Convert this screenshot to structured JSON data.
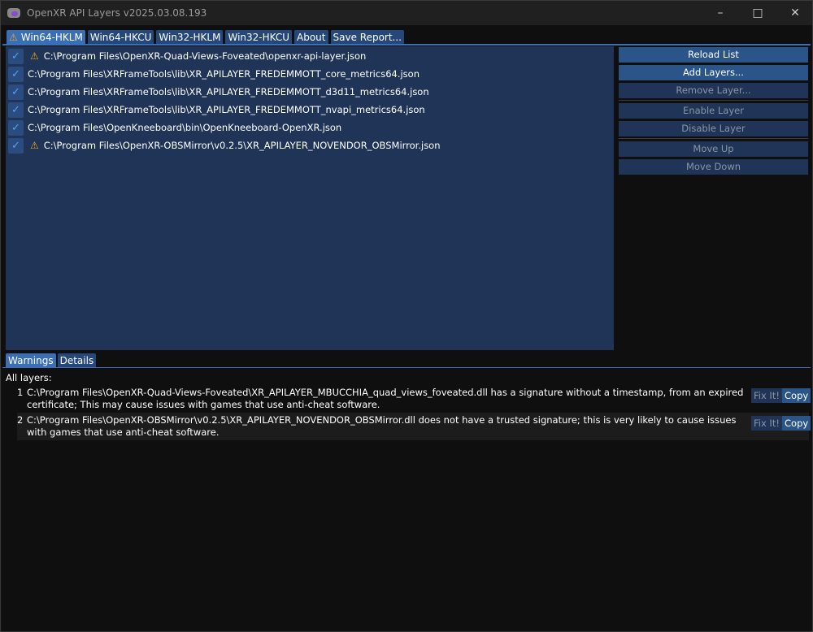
{
  "window": {
    "title": "OpenXR API Layers v2025.03.08.193"
  },
  "tabs": [
    {
      "label": "Win64-HKLM",
      "warning": true
    },
    {
      "label": "Win64-HKCU"
    },
    {
      "label": "Win32-HKLM"
    },
    {
      "label": "Win32-HKCU"
    },
    {
      "label": "About"
    },
    {
      "label": "Save Report..."
    }
  ],
  "layers": [
    {
      "path": "C:\\Program Files\\OpenXR-Quad-Views-Foveated\\openxr-api-layer.json",
      "enabled": true,
      "warning": true
    },
    {
      "path": "C:\\Program Files\\XRFrameTools\\lib\\XR_APILAYER_FREDEMMOTT_core_metrics64.json",
      "enabled": true
    },
    {
      "path": "C:\\Program Files\\XRFrameTools\\lib\\XR_APILAYER_FREDEMMOTT_d3d11_metrics64.json",
      "enabled": true
    },
    {
      "path": "C:\\Program Files\\XRFrameTools\\lib\\XR_APILAYER_FREDEMMOTT_nvapi_metrics64.json",
      "enabled": true
    },
    {
      "path": "C:\\Program Files\\OpenKneeboard\\bin\\OpenKneeboard-OpenXR.json",
      "enabled": true
    },
    {
      "path": "C:\\Program Files\\OpenXR-OBSMirror\\v0.2.5\\XR_APILAYER_NOVENDOR_OBSMirror.json",
      "enabled": true,
      "warning": true
    }
  ],
  "buttons": {
    "reload": "Reload List",
    "add": "Add Layers...",
    "remove": "Remove Layer...",
    "enable": "Enable Layer",
    "disable": "Disable Layer",
    "up": "Move Up",
    "down": "Move Down"
  },
  "bottom_tabs": [
    "Warnings",
    "Details"
  ],
  "warnings": {
    "header": "All layers:",
    "fix_label": "Fix It!",
    "copy_label": "Copy",
    "items": [
      {
        "num": "1",
        "text": "C:\\Program Files\\OpenXR-Quad-Views-Foveated\\XR_APILAYER_MBUCCHIA_quad_views_foveated.dll has a signature without a timestamp, from an expired certificate; This may cause issues with games that use anti-cheat software."
      },
      {
        "num": "2",
        "text": "C:\\Program Files\\OpenXR-OBSMirror\\v0.2.5\\XR_APILAYER_NOVENDOR_OBSMirror.dll does not have a trusted signature; this is very likely to cause issues with games that use anti-cheat software."
      }
    ]
  },
  "icons": {
    "warning": "⚠",
    "check": "✓"
  }
}
